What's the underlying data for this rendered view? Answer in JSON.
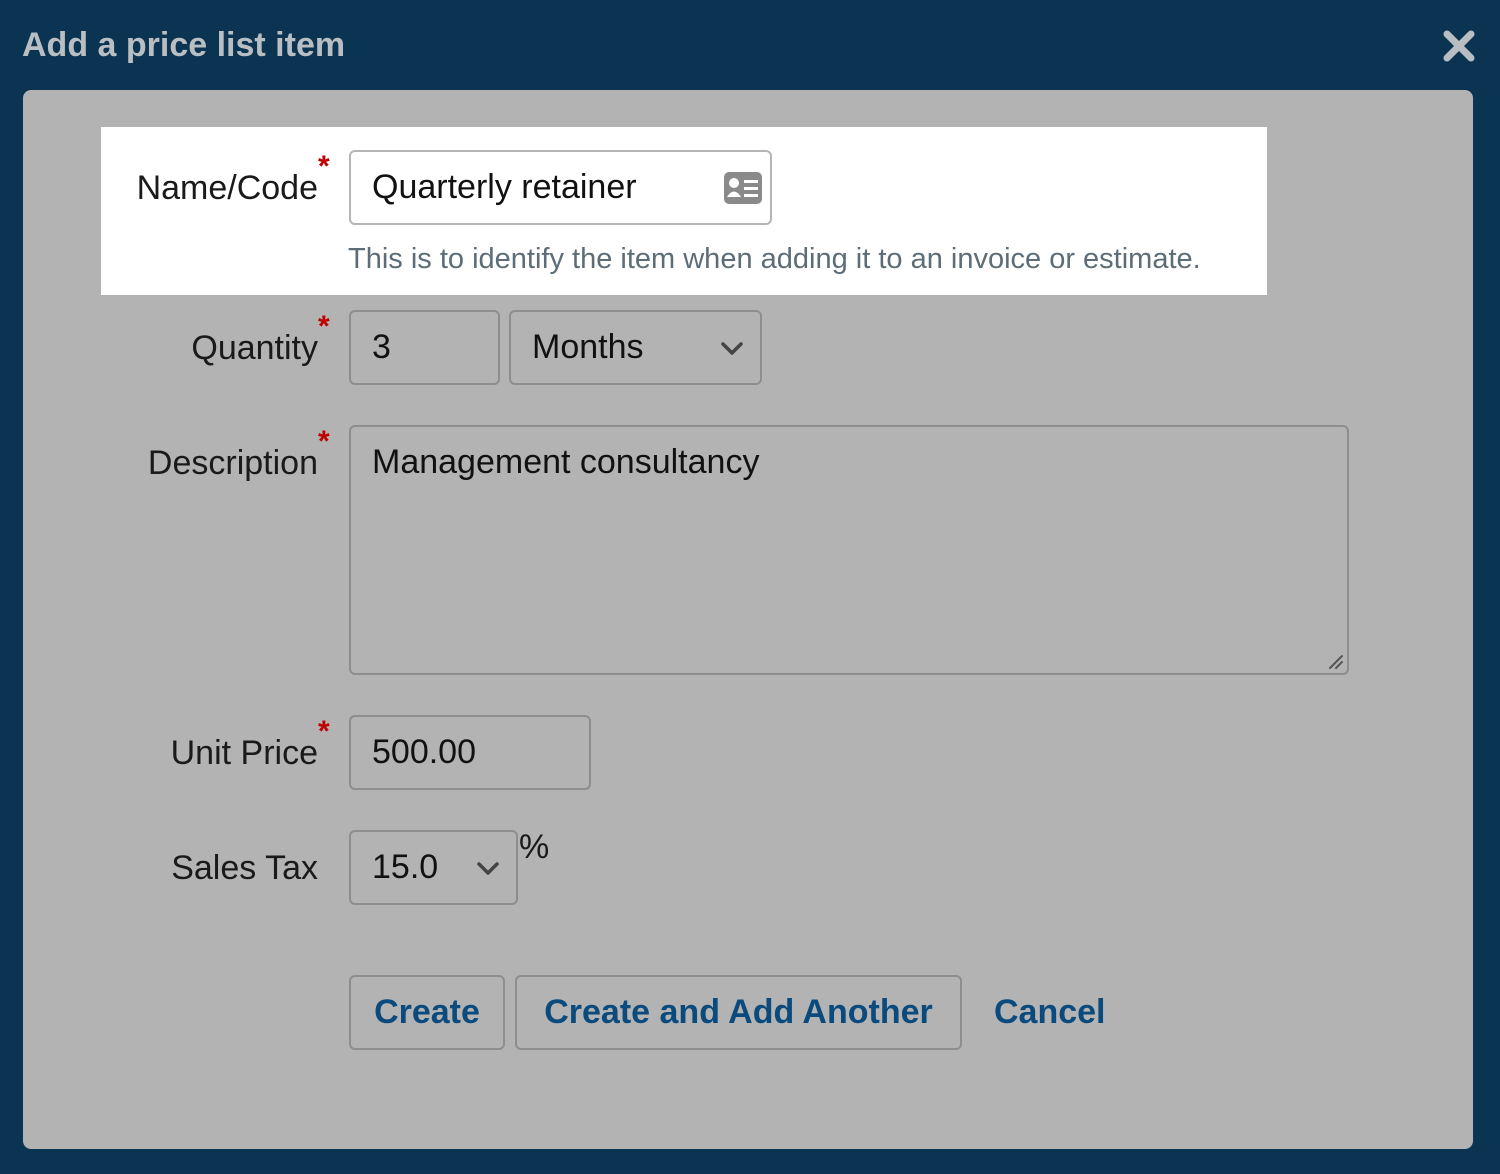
{
  "dialog": {
    "title": "Add a price list item",
    "close_icon": "close-icon"
  },
  "form": {
    "name": {
      "label": "Name/Code",
      "value": "Quarterly retainer",
      "hint": "This is to identify the item when adding it to an invoice or estimate.",
      "icon": "contact-card-icon"
    },
    "quantity": {
      "label": "Quantity",
      "value": "3",
      "unit_selected": "Months"
    },
    "description": {
      "label": "Description",
      "value": "Management consultancy"
    },
    "unit_price": {
      "label": "Unit Price",
      "value": "500.00"
    },
    "sales_tax": {
      "label": "Sales Tax",
      "value": "15.0",
      "suffix": "%"
    },
    "required_marker": "*"
  },
  "actions": {
    "create": "Create",
    "create_another": "Create and Add Another",
    "cancel": "Cancel"
  },
  "colors": {
    "header_bg": "#0a3451",
    "panel_bg": "#b3b3b3",
    "link": "#0a4a7d",
    "required": "#c00000"
  }
}
